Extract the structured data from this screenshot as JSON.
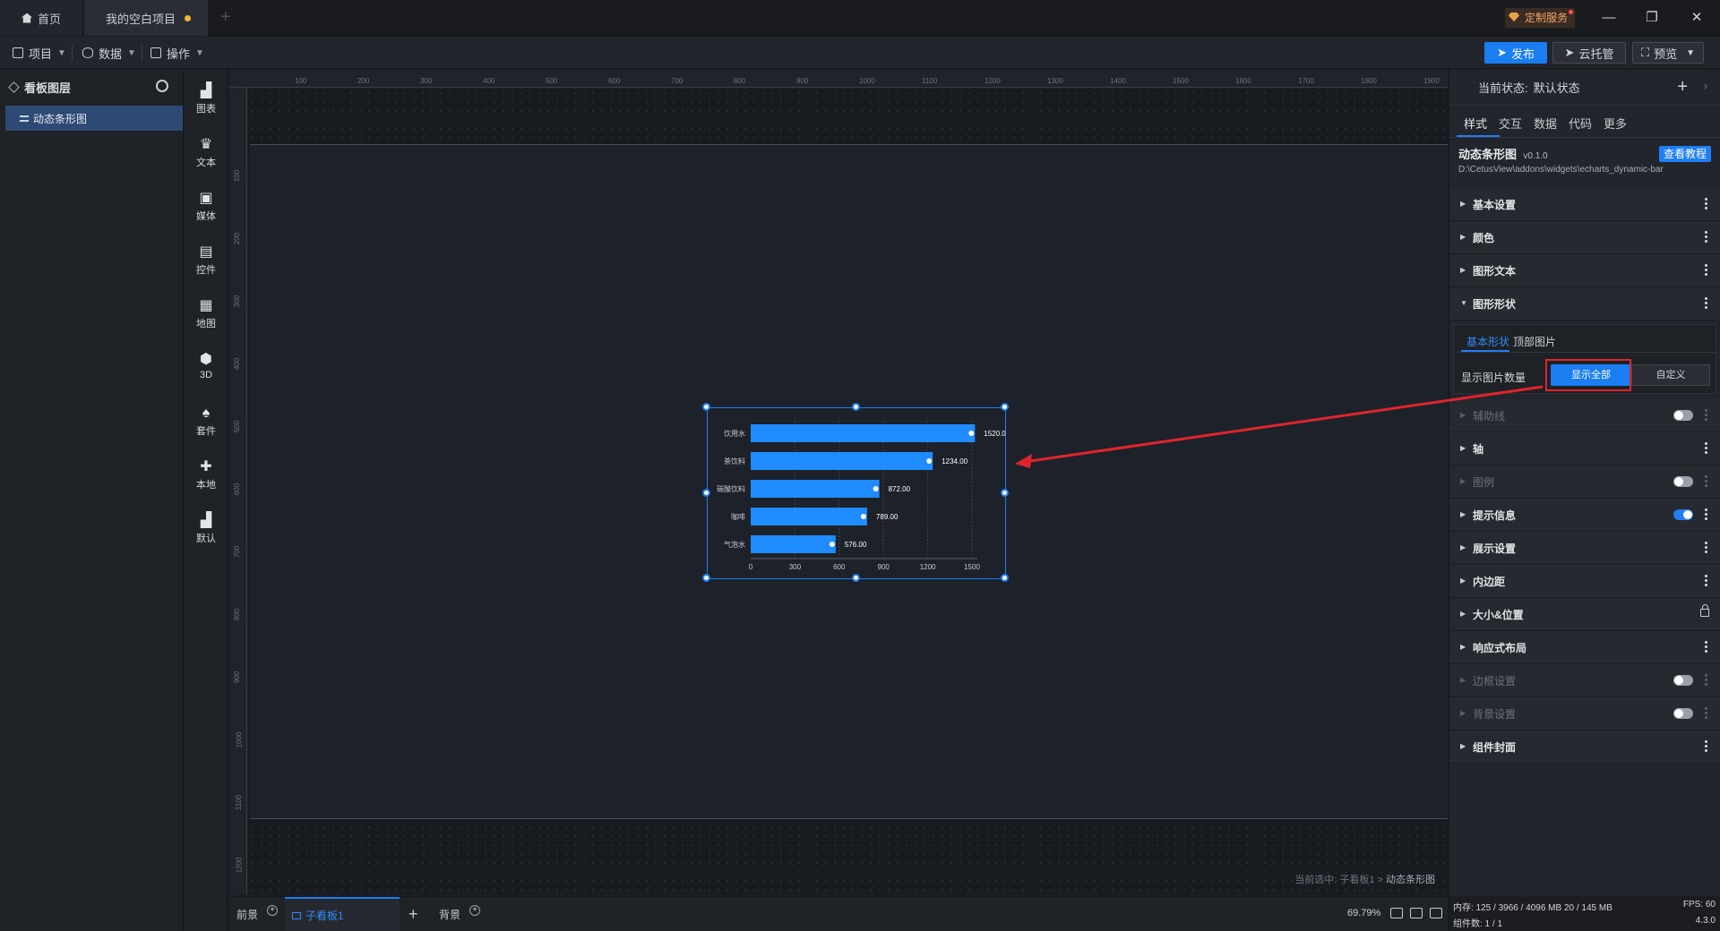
{
  "titlebar": {
    "home_tab": "首页",
    "project_tab": "我的空白项目",
    "custom_service": "定制服务"
  },
  "toolbar": {
    "menus": [
      "项目",
      "数据",
      "操作"
    ],
    "publish": "发布",
    "cloud": "云托管",
    "preview": "预览"
  },
  "layers": {
    "title": "看板图层",
    "items": [
      "动态条形图"
    ]
  },
  "dock": [
    "图表",
    "文本",
    "媒体",
    "控件",
    "地图",
    "3D",
    "套件",
    "本地",
    "默认"
  ],
  "ruler": {
    "top": [
      "100",
      "200",
      "300",
      "400",
      "500",
      "600",
      "700",
      "800",
      "900",
      "1000",
      "1100",
      "1200",
      "1300",
      "1400",
      "1500",
      "1600",
      "1700",
      "1800",
      "1900"
    ],
    "left": [
      "100",
      "200",
      "300",
      "400",
      "500",
      "600",
      "700",
      "800",
      "900",
      "1000",
      "1100",
      "1200"
    ]
  },
  "canvas": {
    "breadcrumb_prefix": "当前选中: 子看板1 >",
    "breadcrumb_current": "动态条形图"
  },
  "chart_data": {
    "type": "bar",
    "orientation": "horizontal",
    "categories": [
      "饮用水",
      "茶饮料",
      "碳酸饮料",
      "咖啡",
      "气泡水"
    ],
    "values": [
      1520.0,
      1234.0,
      872.0,
      789.0,
      576.0
    ],
    "value_labels": [
      "1520.0",
      "1234.00",
      "872.00",
      "789.00",
      "576.00"
    ],
    "x_ticks": [
      "0",
      "300",
      "600",
      "900",
      "1200",
      "1500"
    ],
    "xlim": [
      0,
      1500
    ],
    "color": "#1f8cff",
    "grid": true
  },
  "bottombar": {
    "tabs": [
      "前景",
      "子看板1",
      "背景"
    ],
    "zoom": "69.79%"
  },
  "props": {
    "state_label": "当前状态:",
    "state_value": "默认状态",
    "tabs": [
      "样式",
      "交互",
      "数据",
      "代码",
      "更多"
    ],
    "component_name": "动态条形图",
    "component_version": "v0.1.0",
    "component_path": "D:\\CetusView\\addons\\widgets\\echarts_dynamic-bar",
    "tutorial": "查看教程",
    "sections_before": [
      "基本设置",
      "颜色",
      "图形文本",
      "图形形状"
    ],
    "shape_tabs": [
      "基本形状",
      "顶部图片"
    ],
    "show_count_label": "显示图片数量",
    "show_all": "显示全部",
    "custom": "自定义",
    "sections_after": [
      {
        "label": "辅助线",
        "disabled": true
      },
      {
        "label": "轴",
        "disabled": false
      },
      {
        "label": "图例",
        "disabled": true
      },
      {
        "label": "提示信息",
        "disabled": false
      },
      {
        "label": "展示设置",
        "disabled": false
      },
      {
        "label": "内边距",
        "disabled": false
      },
      {
        "label": "大小&位置",
        "disabled": false
      },
      {
        "label": "响应式布局",
        "disabled": false
      },
      {
        "label": "边框设置",
        "disabled": true
      },
      {
        "label": "背景设置",
        "disabled": true
      },
      {
        "label": "组件封面",
        "disabled": false
      }
    ],
    "status": {
      "memory": "内存: 125 / 3966 / 4096 MB  20 / 145 MB",
      "fps": "FPS: 60",
      "components": "组件数: 1 / 1",
      "version": "4.3.0"
    }
  }
}
